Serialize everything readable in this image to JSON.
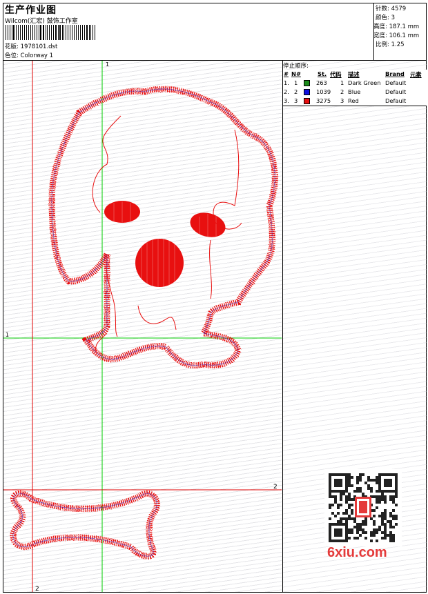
{
  "header": {
    "title": "生产作业图",
    "subtitle": "Wilcom(汇宏) 鼓饰工作室",
    "design_label": "花版:",
    "design_value": "1978101.dst",
    "colorway_label": "色位:",
    "colorway_value": "Colorway 1"
  },
  "stats": {
    "stitches_label": "针数:",
    "stitches_value": "4579",
    "colors_label": "颜色:",
    "colors_value": "3",
    "height_label": "高度:",
    "height_value": "187.1 mm",
    "width_label": "宽度:",
    "width_value": "106.1 mm",
    "scale_label": "比例:",
    "scale_value": "1.25"
  },
  "stop_sequence": {
    "title": "停止顺序:",
    "headers": {
      "num": "#",
      "n": "N#",
      "st": "St.",
      "code": "代码",
      "desc": "描述",
      "brand": "Brand",
      "element": "元素"
    },
    "rows": [
      {
        "num": "1.",
        "n": "1",
        "color": "#1a8a1a",
        "st": "263",
        "code": "1",
        "desc": "Dark Green",
        "brand": "Default"
      },
      {
        "num": "2.",
        "n": "2",
        "color": "#1010e0",
        "st": "1039",
        "code": "2",
        "desc": "Blue",
        "brand": "Default"
      },
      {
        "num": "3.",
        "n": "3",
        "color": "#e81010",
        "st": "3275",
        "code": "3",
        "desc": "Red",
        "brand": "Default"
      }
    ]
  },
  "guides": {
    "green_label_top": "1",
    "green_label_left": "1",
    "red_label_right": "2",
    "red_label_bottom": "2"
  },
  "watermark": "6xiu.com",
  "colors": {
    "stitch": "#e81010",
    "underlay": "#3030d0",
    "guide_green": "#00cc00",
    "guide_red": "#e00000"
  }
}
